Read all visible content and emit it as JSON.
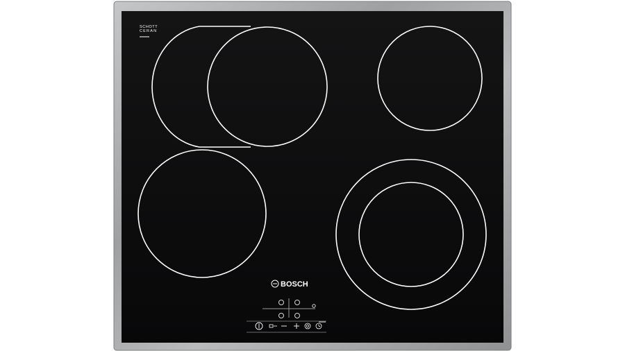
{
  "appliance": {
    "certification_mark": {
      "line1": "SCHOTT",
      "line2": "CERAN"
    },
    "brand": "BOSCH",
    "model_code": "",
    "colors": {
      "glass": "#0e0e0f",
      "frame": "#a9abad",
      "ring": "#ffffff",
      "background": "#ffffff"
    }
  },
  "controls": {
    "zone_selector_icons": [
      "zone-top-left-icon",
      "zone-top-right-icon",
      "zone-bottom-left-icon",
      "zone-bottom-right-icon"
    ],
    "touch_keys": [
      {
        "name": "power-icon"
      },
      {
        "name": "lock-key-icon"
      },
      {
        "name": "minus-icon"
      },
      {
        "name": "plus-icon"
      },
      {
        "name": "bridge-zone-icon"
      },
      {
        "name": "timer-icon"
      }
    ]
  }
}
